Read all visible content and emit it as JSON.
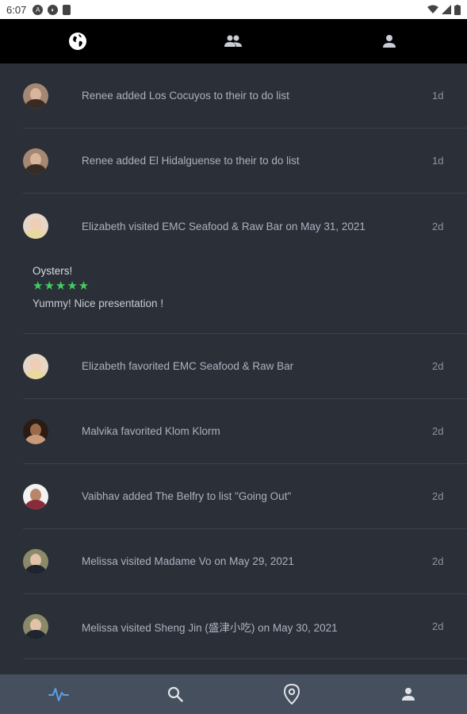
{
  "status_bar": {
    "time": "6:07"
  },
  "top_tabs": [
    {
      "name": "globe",
      "icon": "globe-icon"
    },
    {
      "name": "friends",
      "icon": "group-icon"
    },
    {
      "name": "me",
      "icon": "person-icon"
    }
  ],
  "feed": [
    {
      "text": "Renee added Los Cocuyos to their to do list",
      "time": "1d"
    },
    {
      "text": "Renee added El Hidalguense to their to do list",
      "time": "1d"
    },
    {
      "text": "Elizabeth  visited EMC Seafood & Raw Bar on May 31, 2021",
      "time": "2d",
      "review": {
        "title": "Oysters!",
        "stars": "★★★★★",
        "body": "Yummy!  Nice presentation !"
      }
    },
    {
      "text": "Elizabeth  favorited EMC Seafood & Raw Bar",
      "time": "2d"
    },
    {
      "text": "Malvika favorited Klom Klorm",
      "time": "2d"
    },
    {
      "text": "Vaibhav added The Belfry to list \"Going Out\"",
      "time": "2d"
    },
    {
      "text": "Melissa visited Madame Vo on May 29, 2021",
      "time": "2d"
    },
    {
      "text": "Melissa visited Sheng Jin (盛津小吃) on May 30, 2021",
      "time": "2d"
    }
  ],
  "bottom_nav": [
    {
      "name": "activity",
      "icon": "activity-icon",
      "active": true
    },
    {
      "name": "search",
      "icon": "search-icon"
    },
    {
      "name": "map",
      "icon": "map-pin-icon"
    },
    {
      "name": "profile",
      "icon": "person-icon"
    }
  ],
  "colors": {
    "accent": "#5aa0e6",
    "star": "#3fcf5f",
    "background": "#2b2f38",
    "nav": "#464f5e"
  }
}
